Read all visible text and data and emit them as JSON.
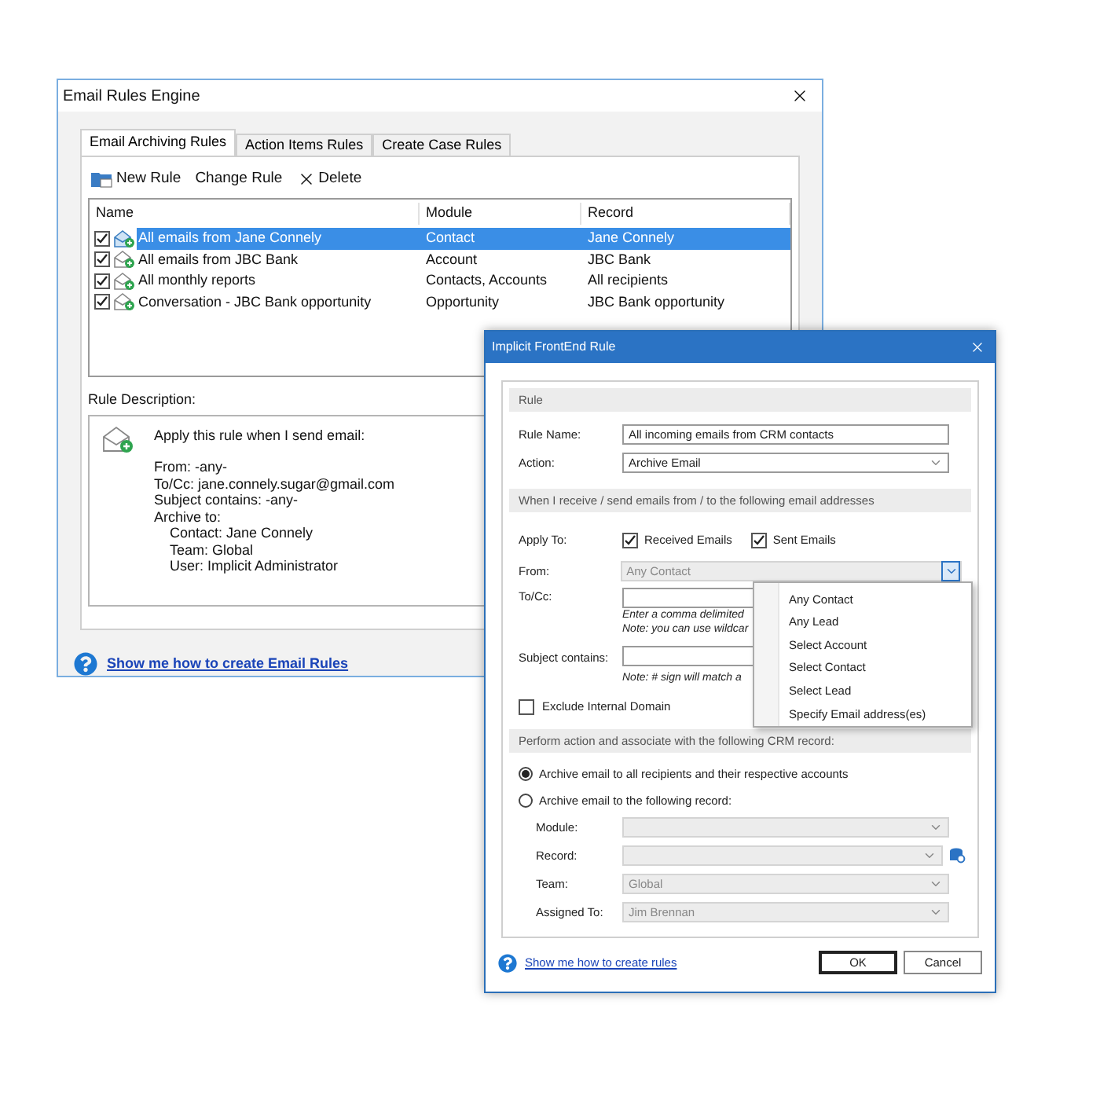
{
  "rules_window": {
    "title": "Email Rules Engine",
    "tabs": [
      {
        "label": "Email Archiving Rules",
        "selected": true
      },
      {
        "label": "Action Items Rules",
        "selected": false
      },
      {
        "label": "Create Case Rules",
        "selected": false
      }
    ],
    "toolbar": [
      {
        "kind": "new",
        "label": "New Rule"
      },
      {
        "kind": "change",
        "label": "Change Rule"
      },
      {
        "kind": "delete",
        "label": "Delete"
      }
    ],
    "table": {
      "columns": [
        "Name",
        "Module",
        "Record"
      ],
      "rows": [
        {
          "checked": true,
          "selected": true,
          "name": "All emails from Jane Connely",
          "module": "Contact",
          "record": "Jane Connely"
        },
        {
          "checked": true,
          "selected": false,
          "name": "All emails from JBC Bank",
          "module": "Account",
          "record": "JBC Bank"
        },
        {
          "checked": true,
          "selected": false,
          "name": "All monthly reports",
          "module": "Contacts, Accounts",
          "record": "All recipients"
        },
        {
          "checked": true,
          "selected": false,
          "name": "Conversation - JBC Bank opportunity",
          "module": "Opportunity",
          "record": "JBC Bank opportunity"
        }
      ]
    },
    "description_label": "Rule Description:",
    "description": {
      "heading": "Apply this rule when I send email:",
      "lines": [
        {
          "text": "From: -any-",
          "indented": false
        },
        {
          "text": "To/Cc: jane.connely.sugar@gmail.com",
          "indented": false
        },
        {
          "text": "Subject contains: -any-",
          "indented": false
        },
        {
          "text": "Archive to:",
          "indented": false
        },
        {
          "text": "Contact: Jane Connely",
          "indented": true
        },
        {
          "text": "Team: Global",
          "indented": true
        },
        {
          "text": "User: Implicit Administrator",
          "indented": true
        }
      ]
    },
    "help_link": "Show me how to create Email Rules"
  },
  "rule_dialog": {
    "title": "Implicit FrontEnd Rule",
    "rule_section": {
      "heading": "Rule",
      "name_label": "Rule Name:",
      "name_value": "All incoming emails from CRM contacts",
      "action_label": "Action:",
      "action_value": "Archive Email"
    },
    "address_section": {
      "heading": "When I receive / send emails from / to the following email addresses",
      "apply_label": "Apply To:",
      "apply_options": [
        {
          "label": "Received Emails",
          "checked": true
        },
        {
          "label": "Sent Emails",
          "checked": true
        }
      ],
      "from_label": "From:",
      "from_value": "Any Contact",
      "to_label": "To/Cc:",
      "to_notes": [
        "Enter a comma delimited",
        "Note: you can use wildcar"
      ],
      "subject_label": "Subject contains:",
      "subject_note": "Note: # sign will match a",
      "exclude": {
        "label": "Exclude Internal Domain",
        "checked": false
      }
    },
    "from_menu": [
      "Any Contact",
      "Any Lead",
      "Select Account",
      "Select Contact",
      "Select Lead",
      "Specify Email address(es)"
    ],
    "record_section": {
      "heading": "Perform action and associate with the following CRM record:",
      "options": [
        {
          "label": "Archive email to all recipients and their respective accounts",
          "selected": true
        },
        {
          "label": "Archive email to the following record:",
          "selected": false
        }
      ],
      "fields": [
        {
          "label": "Module:",
          "lookup": false
        },
        {
          "label": "Record:",
          "lookup": true
        },
        {
          "label": "Team:",
          "value": "Global",
          "lookup": false
        },
        {
          "label": "Assigned To:",
          "value": "Jim Brennan",
          "lookup": false
        }
      ]
    },
    "help_link": "Show me how to create rules",
    "buttons": [
      {
        "label": "OK",
        "default": true
      },
      {
        "label": "Cancel",
        "default": false
      }
    ]
  }
}
